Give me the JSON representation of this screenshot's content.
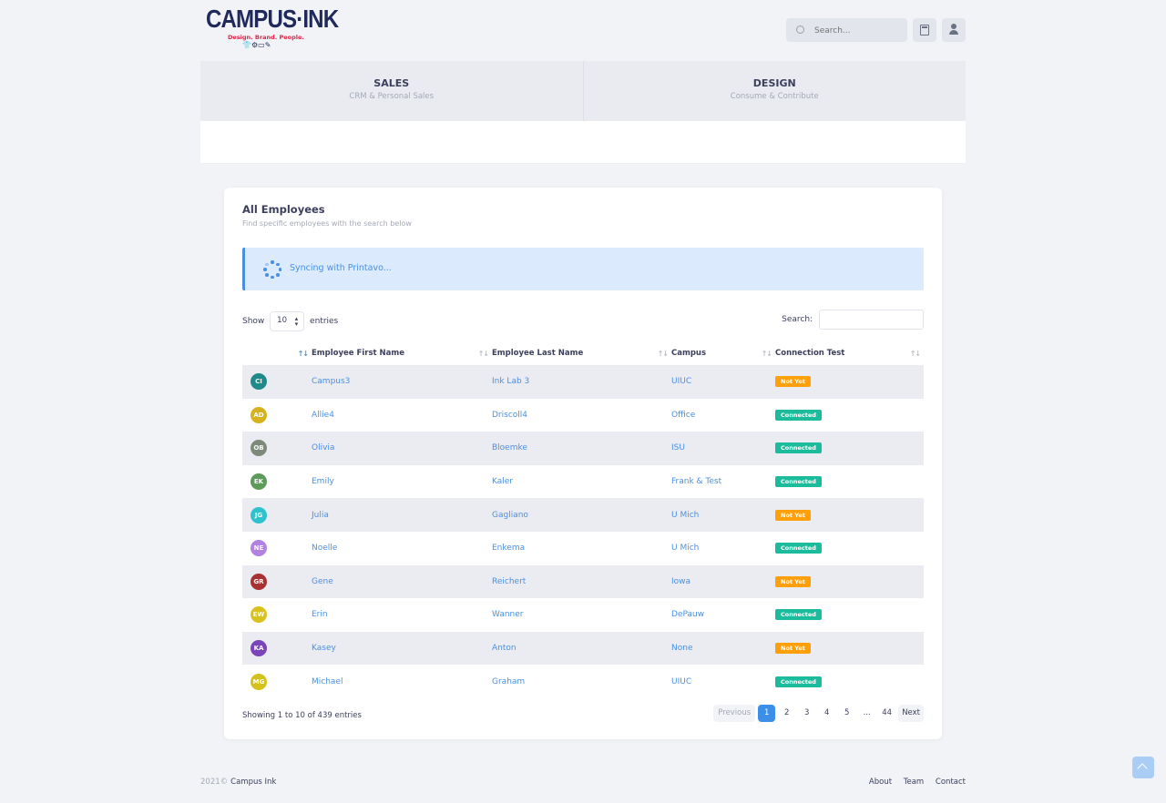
{
  "logo": {
    "word": "CAMPUS·INK",
    "tagline": "Design. Brand. People.",
    "icons": "👕⚙▭✎"
  },
  "header": {
    "search_placeholder": "Search..."
  },
  "nav": [
    {
      "title": "SALES",
      "subtitle": "CRM & Personal Sales"
    },
    {
      "title": "DESIGN",
      "subtitle": "Consume & Contribute"
    }
  ],
  "card": {
    "title": "All Employees",
    "subtitle": "Find specific employees with the search below"
  },
  "alert": {
    "text": "Syncing with Printavo..."
  },
  "table_controls": {
    "show_label": "Show",
    "entries_value": "10",
    "entries_label": "entries",
    "search_label": "Search:"
  },
  "columns": [
    "",
    "Employee First Name",
    "Employee Last Name",
    "Campus",
    "Connection Test"
  ],
  "rows": [
    {
      "initials": "CI",
      "color": "#1f8a8a",
      "first": "Campus3",
      "last": "Ink Lab 3",
      "campus": "UIUC",
      "status": "Not Yet"
    },
    {
      "initials": "AD",
      "color": "#d6b21e",
      "first": "Allie4",
      "last": "Driscoll4",
      "campus": "Office",
      "status": "Connected"
    },
    {
      "initials": "OB",
      "color": "#7d8a79",
      "first": "Olivia",
      "last": "Bloemke",
      "campus": "ISU",
      "status": "Connected"
    },
    {
      "initials": "EK",
      "color": "#5e9a5a",
      "first": "Emily",
      "last": "Kaler",
      "campus": "Frank & Test",
      "status": "Connected"
    },
    {
      "initials": "JG",
      "color": "#2ec3cc",
      "first": "Julia",
      "last": "Gagliano",
      "campus": "U Mich",
      "status": "Not Yet"
    },
    {
      "initials": "NE",
      "color": "#b182e0",
      "first": "Noelle",
      "last": "Enkema",
      "campus": "U Mich",
      "status": "Connected"
    },
    {
      "initials": "GR",
      "color": "#a83232",
      "first": "Gene",
      "last": "Reichert",
      "campus": "Iowa",
      "status": "Not Yet"
    },
    {
      "initials": "EW",
      "color": "#d9c21f",
      "first": "Erin",
      "last": "Wanner",
      "campus": "DePauw",
      "status": "Connected"
    },
    {
      "initials": "KA",
      "color": "#7a45b8",
      "first": "Kasey",
      "last": "Anton",
      "campus": "None",
      "status": "Not Yet"
    },
    {
      "initials": "MG",
      "color": "#d4c11b",
      "first": "Michael",
      "last": "Graham",
      "campus": "UIUC",
      "status": "Connected"
    }
  ],
  "info": "Showing 1 to 10 of 439 entries",
  "pager": {
    "prev": "Previous",
    "pages": [
      "1",
      "2",
      "3",
      "4",
      "5",
      "...",
      "44"
    ],
    "next": "Next"
  },
  "footer": {
    "year": "2021©",
    "brand": "Campus Ink",
    "links": [
      "About",
      "Team",
      "Contact"
    ]
  }
}
